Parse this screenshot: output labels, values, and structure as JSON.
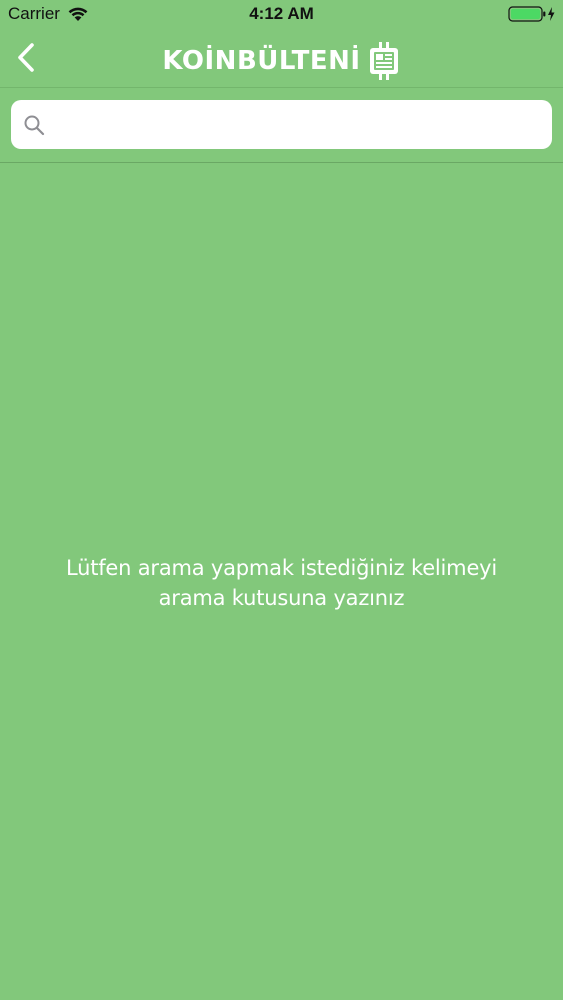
{
  "status_bar": {
    "carrier": "Carrier",
    "time": "4:12 AM",
    "wifi_icon": "wifi-icon",
    "battery_icon": "battery-charging-icon"
  },
  "nav": {
    "back_icon": "chevron-left-icon",
    "logo_part1": "KOİN",
    "logo_part2": "BÜLTENİ",
    "logo_badge_icon": "newspaper-icon"
  },
  "search": {
    "icon": "search-icon",
    "value": "",
    "placeholder": ""
  },
  "empty_state": {
    "message": "Lütfen arama yapmak istediğiniz kelimeyi arama kutusuna yazınız"
  },
  "colors": {
    "background": "#82c87b",
    "text": "#ffffff",
    "search_field": "#ffffff",
    "battery": "#4cd964"
  }
}
